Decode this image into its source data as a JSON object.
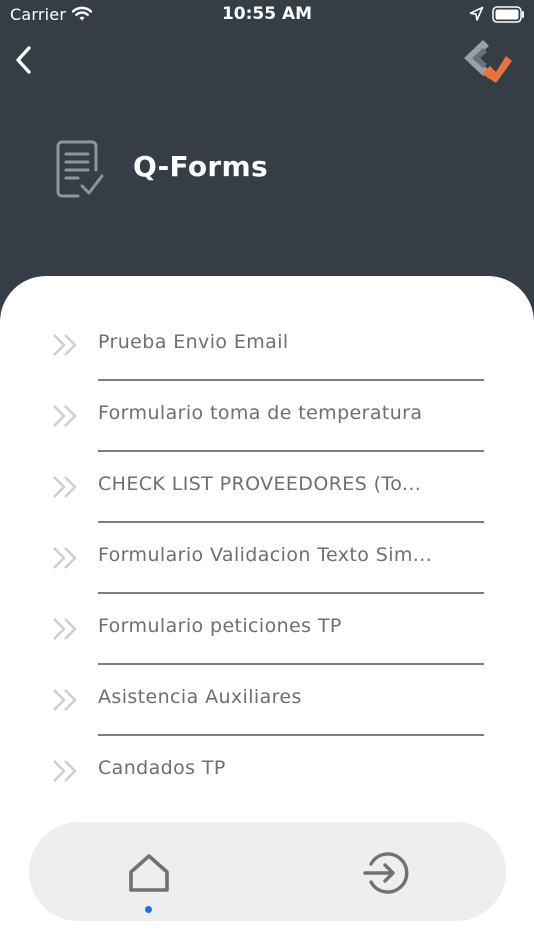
{
  "status_bar": {
    "carrier": "Carrier",
    "time": "10:55 AM",
    "icons": [
      "wifi-icon",
      "location-arrow-icon",
      "battery-icon"
    ]
  },
  "header": {
    "back_icon": "chevron-left-icon",
    "brand_logo": "brand-logo",
    "title_icon": "form-checklist-icon",
    "title": "Q-Forms",
    "background_color": "#353e46"
  },
  "forms": [
    {
      "label": "Prueba Envio Email"
    },
    {
      "label": "Formulario toma de temperatura"
    },
    {
      "label": "CHECK LIST PROVEEDORES (To..."
    },
    {
      "label": "Formulario Validacion Texto Sim..."
    },
    {
      "label": "Formulario peticiones TP"
    },
    {
      "label": "Asistencia Auxiliares"
    },
    {
      "label": "Candados TP"
    }
  ],
  "bottom_nav": {
    "items": [
      {
        "icon": "home-icon",
        "active": true
      },
      {
        "icon": "logout-icon",
        "active": false
      }
    ],
    "active_indicator_color": "#1a73e8"
  }
}
